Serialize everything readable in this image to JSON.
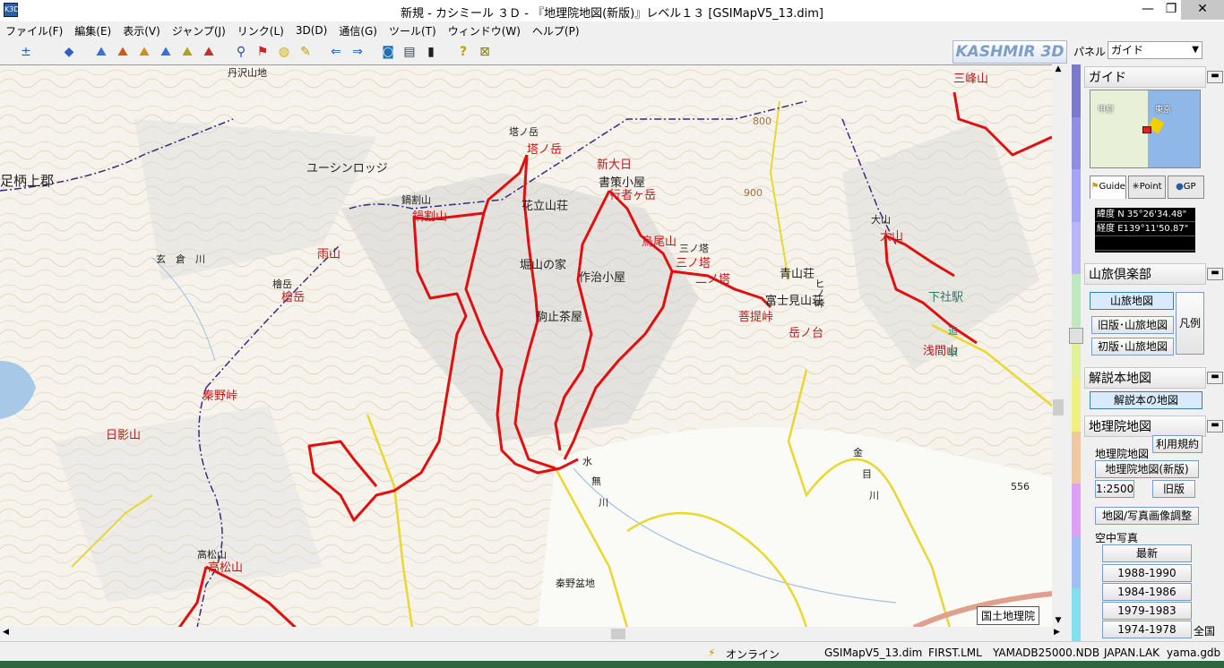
{
  "window": {
    "title": "新規 - カシミール ３Ｄ - 『地理院地図(新版)』レベル１３ [GSIMapV5_13.dim]",
    "minimize": "—",
    "maximize": "❐",
    "close": "✕"
  },
  "menu": [
    {
      "label": "ファイル(F)"
    },
    {
      "label": "編集(E)"
    },
    {
      "label": "表示(V)"
    },
    {
      "label": "ジャンプ(J)"
    },
    {
      "label": "リンク(L)"
    },
    {
      "label": "3D(D)"
    },
    {
      "label": "通信(G)"
    },
    {
      "label": "ツール(T)"
    },
    {
      "label": "ウィンドウ(W)"
    },
    {
      "label": "ヘルプ(P)"
    }
  ],
  "toolbar": {
    "logo": "KASHMIR 3D",
    "panel_label": "パネル",
    "panel_value": "ガイド",
    "buttons": [
      {
        "name": "zoom-icon",
        "glyph": "±"
      },
      {
        "name": "layer-icon",
        "glyph": "◆"
      },
      {
        "name": "terrain-icon",
        "glyph": "⛰"
      },
      {
        "name": "terrain2-icon",
        "glyph": "⛰"
      },
      {
        "name": "terrain3-icon",
        "glyph": "⛰"
      },
      {
        "name": "terrain4-icon",
        "glyph": "⛰"
      },
      {
        "name": "terrain5-icon",
        "glyph": "⛰"
      },
      {
        "name": "terrain6-icon",
        "glyph": "⛰"
      },
      {
        "name": "binoculars-icon",
        "glyph": "⚲"
      },
      {
        "name": "marker-icon",
        "glyph": "⚑"
      },
      {
        "name": "palette-icon",
        "glyph": "◍"
      },
      {
        "name": "ruler-icon",
        "glyph": "✎"
      },
      {
        "name": "back-icon",
        "glyph": "⇐"
      },
      {
        "name": "forward-icon",
        "glyph": "⇒"
      },
      {
        "name": "camera-icon",
        "glyph": "◙"
      },
      {
        "name": "film-icon",
        "glyph": "▤"
      },
      {
        "name": "gps-icon",
        "glyph": "▮"
      },
      {
        "name": "help-icon",
        "glyph": "?"
      },
      {
        "name": "exit-icon",
        "glyph": "⊠"
      }
    ]
  },
  "map": {
    "labels": [
      {
        "text": "丹沢山地",
        "color": "black",
        "size": "small"
      },
      {
        "text": "足柄上郡",
        "color": "black",
        "size": "big"
      },
      {
        "text": "ユーシンロッジ",
        "color": "black"
      },
      {
        "text": "塔ノ岳",
        "color": "black",
        "size": "small"
      },
      {
        "text": "塔ノ岳",
        "color": "red"
      },
      {
        "text": "新大日",
        "color": "red"
      },
      {
        "text": "書策小屋",
        "color": "black"
      },
      {
        "text": "行者ヶ岳",
        "color": "red"
      },
      {
        "text": "鍋割山",
        "color": "black",
        "size": "small"
      },
      {
        "text": "鍋割山",
        "color": "red"
      },
      {
        "text": "花立山荘",
        "color": "black"
      },
      {
        "text": "雨山",
        "color": "red"
      },
      {
        "text": "玄　倉　川",
        "color": "black",
        "size": "small"
      },
      {
        "text": "堀山の家",
        "color": "black"
      },
      {
        "text": "作治小屋",
        "color": "black"
      },
      {
        "text": "烏尾山",
        "color": "red"
      },
      {
        "text": "三ノ塔",
        "color": "red"
      },
      {
        "text": "二ノ塔",
        "color": "red"
      },
      {
        "text": "青山荘",
        "color": "black"
      },
      {
        "text": "富士見山荘",
        "color": "black"
      },
      {
        "text": "菩提峠",
        "color": "red"
      },
      {
        "text": "岳ノ台",
        "color": "red"
      },
      {
        "text": "檜岳",
        "color": "black",
        "size": "small"
      },
      {
        "text": "檜岳",
        "color": "red"
      },
      {
        "text": "駒止茶屋",
        "color": "black"
      },
      {
        "text": "秦野峠",
        "color": "red"
      },
      {
        "text": "日影山",
        "color": "red"
      },
      {
        "text": "水",
        "color": "black",
        "size": "small"
      },
      {
        "text": "無",
        "color": "black",
        "size": "small"
      },
      {
        "text": "川",
        "color": "black",
        "size": "small"
      },
      {
        "text": "秦野盆地",
        "color": "black",
        "size": "small"
      },
      {
        "text": "高松山",
        "color": "black",
        "size": "small"
      },
      {
        "text": "高松山",
        "color": "red"
      },
      {
        "text": "大山",
        "color": "black",
        "size": "small"
      },
      {
        "text": "大山",
        "color": "red"
      },
      {
        "text": "下社駅",
        "color": "green"
      },
      {
        "text": "浅間山",
        "color": "red"
      },
      {
        "text": "三峰山",
        "color": "red"
      },
      {
        "text": "金",
        "color": "black",
        "size": "small"
      },
      {
        "text": "目",
        "color": "black",
        "size": "small"
      },
      {
        "text": "川",
        "color": "black",
        "size": "small"
      },
      {
        "text": "556",
        "color": "black",
        "size": "small"
      },
      {
        "text": "800",
        "color": "brown",
        "size": "small"
      },
      {
        "text": "900",
        "color": "brown",
        "size": "small"
      },
      {
        "text": "三ノ塔",
        "color": "black",
        "size": "small"
      },
      {
        "text": "ヒノ峠",
        "color": "black",
        "size": "small"
      },
      {
        "text": "追",
        "color": "green",
        "size": "small"
      },
      {
        "text": "駅",
        "color": "green",
        "size": "small"
      }
    ],
    "copyright": "国土地理院"
  },
  "colorbar": [
    "#7a7ac8",
    "#8f8fe0",
    "#a6a6f0",
    "#b8b8f8",
    "#c0e8c0",
    "#e0f0a0",
    "#f0f080",
    "#f0c8a0",
    "#e0a0f0",
    "#a0c0f0",
    "#80e0f0"
  ],
  "right_panel": {
    "guide": {
      "title": "ガイド",
      "minimize": "▬",
      "cities": [
        "甲府",
        "東京"
      ],
      "tabs": [
        "Guide",
        "Point",
        "GP"
      ],
      "lat_label": "緯度",
      "lat_value": "N 35°26'34.48\"",
      "lon_label": "経度",
      "lon_value": "E139°11'50.87\"",
      "empty": ""
    },
    "sanryo": {
      "title": "山旅倶楽部",
      "buttons": [
        "山旅地図",
        "旧版･山旅地図",
        "初版･山旅地図"
      ],
      "legend": "凡例"
    },
    "kaisetsu": {
      "title": "解説本地図",
      "button": "解説本の地図"
    },
    "chiriin": {
      "title": "地理院地図",
      "terms": "利用規約",
      "section_label": "地理院地図",
      "buttons": [
        "地理院地図(新版)",
        "1:2500",
        "旧版",
        "地図/写真画像調整"
      ],
      "photo_label": "空中写真",
      "photo_buttons": [
        "最新",
        "1988-1990",
        "1984-1986",
        "1979-1983",
        "1974-1978"
      ],
      "all_label": "全国"
    }
  },
  "status": {
    "online": "オンライン",
    "items": [
      "GSIMapV5_13.dim",
      "FIRST.LML",
      "YAMADB25000.NDB",
      "JAPAN.LAK",
      "yama.gdb"
    ]
  }
}
